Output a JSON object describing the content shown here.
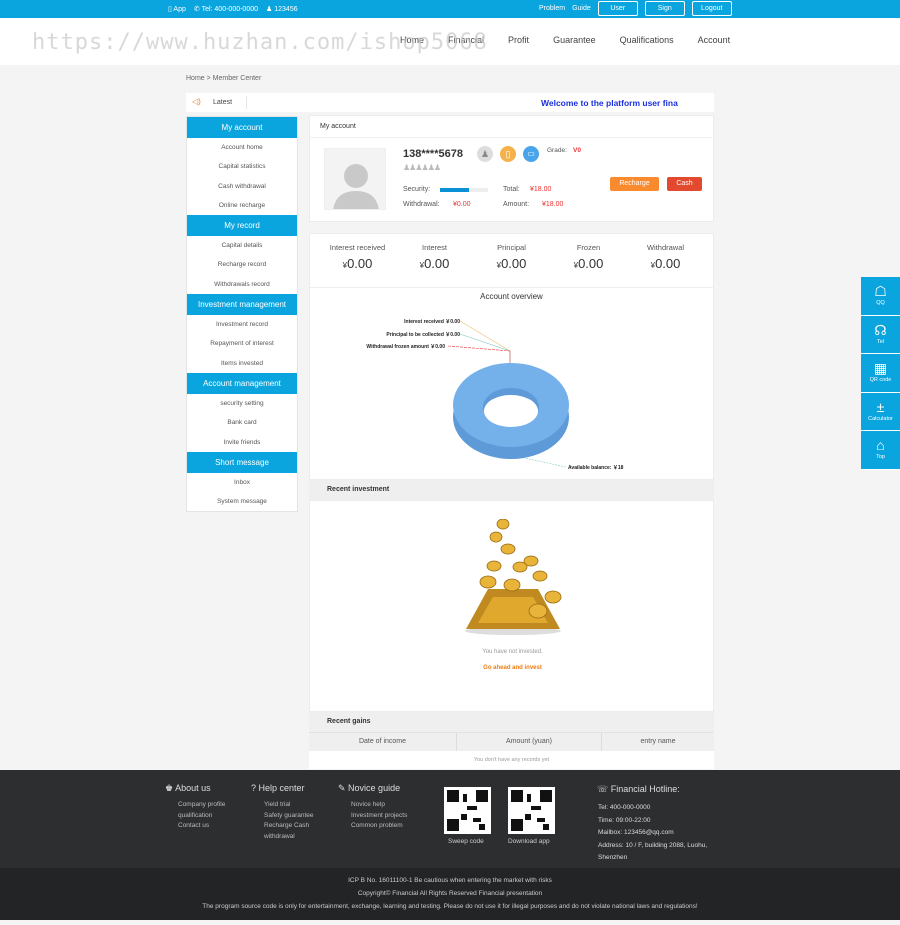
{
  "topbar": {
    "app": "App",
    "tel": "Tel: 400-000-0000",
    "qq": "123456",
    "links": [
      "Problem",
      "Guide"
    ],
    "buttons": [
      "User",
      "Sign",
      "Logout"
    ]
  },
  "watermark": "https://www.huzhan.com/ishop5068",
  "nav": [
    "Home",
    "Financial",
    "Profit",
    "Guarantee",
    "Qualifications",
    "Account"
  ],
  "breadcrumb": "Home > Member Center",
  "notice": {
    "label": "Latest",
    "text": "Welcome to the platform user fina"
  },
  "sidebar": [
    {
      "title": "My account",
      "items": [
        "Account home",
        "Capital statistics",
        "Cash withdrawal",
        "Online recharge"
      ]
    },
    {
      "title": "My record",
      "items": [
        "Capital details",
        "Recharge record",
        "Withdrawals record"
      ]
    },
    {
      "title": "Investment management",
      "items": [
        "Investment record",
        "Repayment of interest",
        "Items invested"
      ]
    },
    {
      "title": "Account management",
      "items": [
        "security setting",
        "Bank card",
        "Invite friends"
      ]
    },
    {
      "title": "Short message",
      "items": [
        "Inbox",
        "System message"
      ]
    }
  ],
  "account": {
    "title": "My account",
    "phone": "138****5678",
    "grade_label": "Grade:",
    "grade": "V0",
    "security_label": "Security:",
    "security_level": 0.6,
    "total_label": "Total:",
    "total": "¥18.00",
    "withdrawal_label": "Withdrawal:",
    "withdrawal": "¥0.00",
    "amount_label": "Amount:",
    "amount": "¥18.00",
    "recharge": "Recharge",
    "cash": "Cash",
    "colors": {
      "recharge": "#fa8a2e",
      "cash": "#e3492f"
    }
  },
  "stats": [
    {
      "label": "Interest received",
      "value": "0.00"
    },
    {
      "label": "Interest",
      "value": "0.00"
    },
    {
      "label": "Principal",
      "value": "0.00"
    },
    {
      "label": "Frozen",
      "value": "0.00"
    },
    {
      "label": "Withdrawal",
      "value": "0.00"
    }
  ],
  "currency": "¥",
  "overview": {
    "title": "Account overview",
    "labels": [
      "Interest received ￥0.00",
      "Principal to be collected ￥0.00",
      "Withdrawal frozen amount ￥0.00",
      "Available balance: ￥18"
    ]
  },
  "chart_data": {
    "type": "pie",
    "title": "Account overview",
    "categories": [
      "Interest received",
      "Principal to be collected",
      "Withdrawal frozen amount",
      "Available balance"
    ],
    "values": [
      0,
      0,
      0,
      18
    ],
    "color": "#74b0ea"
  },
  "recent_investment": {
    "title": "Recent investment",
    "empty": "You have not invested.",
    "link": "Go ahead and invest"
  },
  "recent_gains": {
    "title": "Recent gains",
    "columns": [
      "Date of income",
      "Amount (yuan)",
      "entry name"
    ],
    "empty": "You don't have any records yet"
  },
  "float": [
    "QQ",
    "Tel",
    "QR code",
    "Calculator",
    "Top"
  ],
  "footer": {
    "cols": [
      {
        "title": "About us",
        "items": [
          "Company profile",
          "qualification",
          "Contact us"
        ]
      },
      {
        "title": "Help center",
        "items": [
          "Yield trial",
          "Safety guarantee",
          "Recharge Cash",
          "withdrawal"
        ]
      },
      {
        "title": "Novice guide",
        "items": [
          "Novice help",
          "Investment projects",
          "Common problem"
        ]
      }
    ],
    "qr": [
      "Sweep code",
      "Download app"
    ],
    "hotline": {
      "title": "Financial Hotline:",
      "lines": [
        "Tel:  400-000-0000",
        "Time:   09:00-22:00",
        "Mailbox:  123456@qq.com",
        "Address:  10 / F, building 2088, Luohu,",
        "Shenzhen"
      ]
    },
    "bottom": [
      "ICP B No. 16011100-1 Be cautious when entering the market with risks",
      "Copyright© Financial All Rights Reserved  Financial presentation",
      "The program source code is only for entertainment, exchange, learning and testing. Please do not use it for illegal purposes and do not violate national laws and regulations!"
    ]
  }
}
